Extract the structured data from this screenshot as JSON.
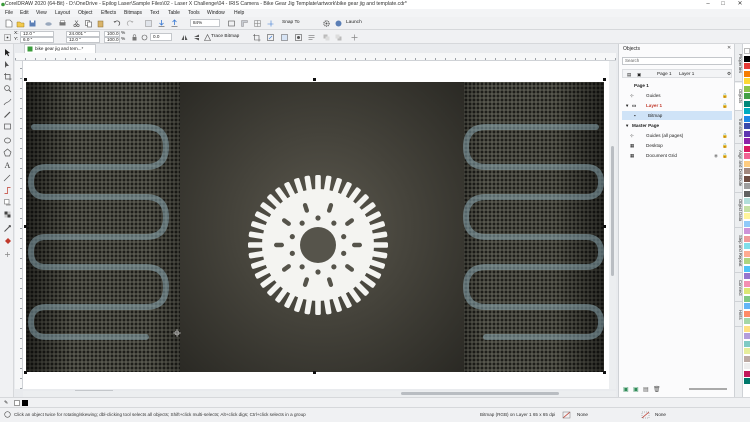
{
  "window": {
    "title": "CorelDRAW 2020 (64-Bit) - D:\\OneDrive - Epilog Laser\\Sample Files\\02 - Laser X Challenge\\04 - IRIS Camera - Bike Gear Jig Template\\artwork\\bike gear jig and template.cdr*",
    "minimize": "–",
    "maximize": "□",
    "close": "✕"
  },
  "menu": [
    "File",
    "Edit",
    "View",
    "Layout",
    "Object",
    "Effects",
    "Bitmaps",
    "Text",
    "Table",
    "Tools",
    "Window",
    "Help"
  ],
  "toolbar": {
    "zoom": "84%",
    "snap_to": "Snap To",
    "launch": "Launch"
  },
  "propbar": {
    "x_label": "X:",
    "x_value": "12.0 \"",
    "y_label": "Y:",
    "y_value": "6.0 \"",
    "w_value": "24.001 \"",
    "h_value": "12.0 \"",
    "scale_w": "100.0",
    "scale_h": "100.0",
    "pct": "%",
    "rotation": "0.0",
    "trace": "Trace Bitmap"
  },
  "doc_tab": {
    "label": "bike gear jig and tem...*"
  },
  "page_tab": {
    "label": "Page 1"
  },
  "objects_panel": {
    "title": "Objects",
    "search_placeholder": "Search",
    "page_selector": "Page 1",
    "layer_selector": "Layer 1",
    "rows": {
      "page1": "Page 1",
      "guides": "Guides",
      "layer1": "Layer 1",
      "bitmap": "Bitmap",
      "master_page": "Master Page",
      "guides_all": "Guides (all pages)",
      "desktop": "Desktop",
      "document_grid": "Document Grid"
    }
  },
  "docker_tabs": [
    "Properties",
    "Objects",
    "Transform",
    "Align and Distribute",
    "Object Data",
    "Step and Repeat",
    "Connect",
    "Hints"
  ],
  "status": {
    "hint": "Click an object twice for rotating/skewing; dbl-clicking tool selects all objects; Shift+click multi-selects; Alt+click digs; Ctrl+click selects in a group",
    "object_info": "Bitmap (RGB) on Layer 1 65 x 65 dpi",
    "fill": "None",
    "outline": "None"
  },
  "palette_colors": [
    "#ffffff",
    "#000000",
    "#e53935",
    "#f57c00",
    "#fdd835",
    "#8bc34a",
    "#43a047",
    "#00897b",
    "#00acc1",
    "#1e88e5",
    "#3949ab",
    "#5e35b1",
    "#8e24aa",
    "#d81b60",
    "#f06292",
    "#ffcc80",
    "#a1887f",
    "#6d4c41",
    "#9e9e9e",
    "#616161",
    "#b2dfdb",
    "#c5e1a5",
    "#fff59d",
    "#90caf9",
    "#ce93d8",
    "#ef9a9a",
    "#80deea",
    "#ffab91",
    "#aed581",
    "#4fc3f7",
    "#9575cd",
    "#f48fb1",
    "#dce775",
    "#81c784",
    "#64b5f6",
    "#ff8a65",
    "#a5d6a7",
    "#ffe082",
    "#b39ddb",
    "#80cbc4",
    "#e6ee9c",
    "#bcaaa4",
    "#eeeeee",
    "#c2185b",
    "#00796b"
  ]
}
